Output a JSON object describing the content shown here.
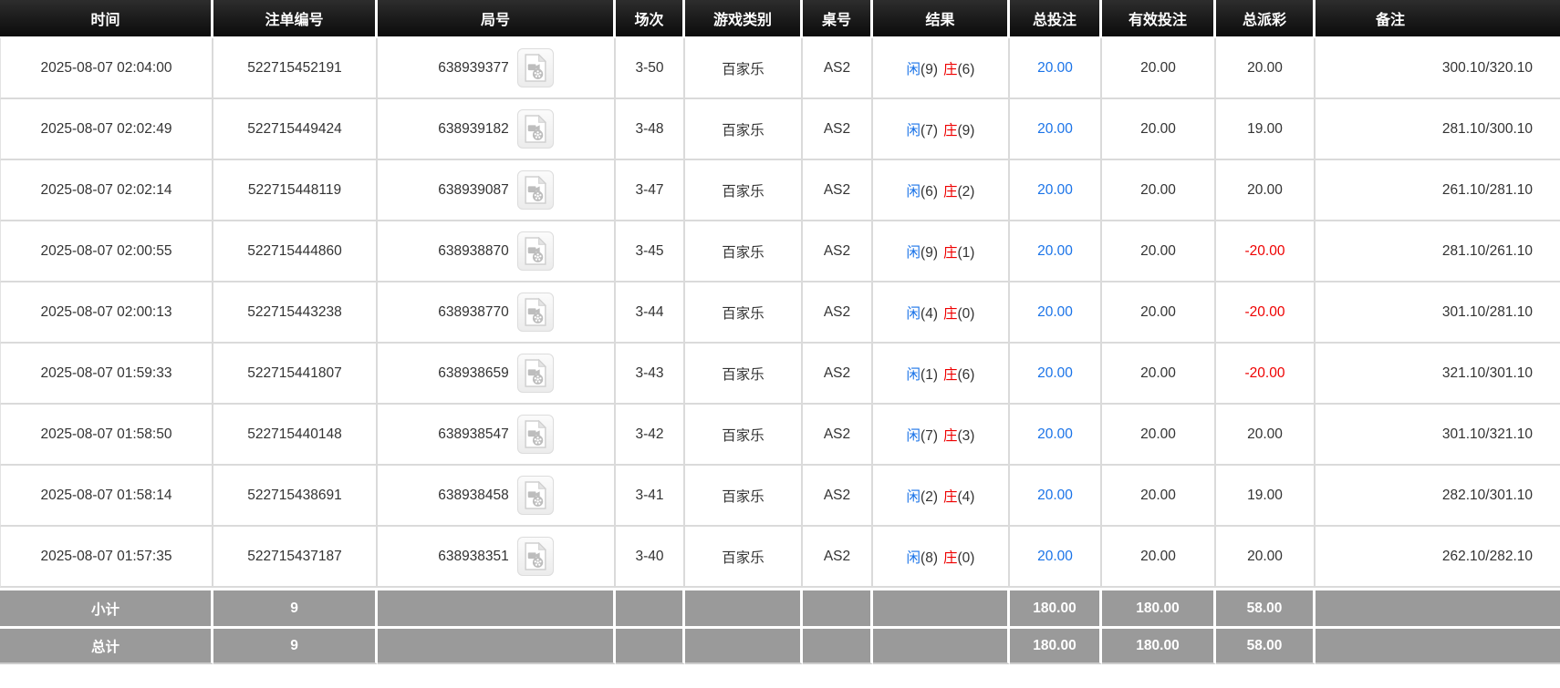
{
  "colors": {
    "header_bg": "#1a1a1a",
    "summary_bg": "#9a9a9a",
    "accent_blue": "#1a73e8",
    "result_player_blue": "#1a73e8",
    "result_banker_red": "#ee0000",
    "negative_red": "#ee0000",
    "border_gray": "#dadada"
  },
  "table": {
    "columns": [
      {
        "label": "时间"
      },
      {
        "label": "注单编号"
      },
      {
        "label": "局号"
      },
      {
        "label": "场次"
      },
      {
        "label": "游戏类别"
      },
      {
        "label": "桌号"
      },
      {
        "label": "结果"
      },
      {
        "label": "总投注"
      },
      {
        "label": "有效投注"
      },
      {
        "label": "总派彩"
      },
      {
        "label": "备注"
      }
    ],
    "rows": [
      {
        "time": "2025-08-07 02:04:00",
        "bet_no": "522715452191",
        "round_no": "638939377",
        "session": "3-50",
        "game_type": "百家乐",
        "table_no": "AS2",
        "player": "闲",
        "player_score": "(9)",
        "banker": "庄",
        "banker_score": "(6)",
        "total_bet": "20.00",
        "valid_bet": "20.00",
        "total_payout": "20.00",
        "remark": "300.10/320.10"
      },
      {
        "time": "2025-08-07 02:02:49",
        "bet_no": "522715449424",
        "round_no": "638939182",
        "session": "3-48",
        "game_type": "百家乐",
        "table_no": "AS2",
        "player": "闲",
        "player_score": "(7)",
        "banker": "庄",
        "banker_score": "(9)",
        "total_bet": "20.00",
        "valid_bet": "20.00",
        "total_payout": "19.00",
        "remark": "281.10/300.10"
      },
      {
        "time": "2025-08-07 02:02:14",
        "bet_no": "522715448119",
        "round_no": "638939087",
        "session": "3-47",
        "game_type": "百家乐",
        "table_no": "AS2",
        "player": "闲",
        "player_score": "(6)",
        "banker": "庄",
        "banker_score": "(2)",
        "total_bet": "20.00",
        "valid_bet": "20.00",
        "total_payout": "20.00",
        "remark": "261.10/281.10"
      },
      {
        "time": "2025-08-07 02:00:55",
        "bet_no": "522715444860",
        "round_no": "638938870",
        "session": "3-45",
        "game_type": "百家乐",
        "table_no": "AS2",
        "player": "闲",
        "player_score": "(9)",
        "banker": "庄",
        "banker_score": "(1)",
        "total_bet": "20.00",
        "valid_bet": "20.00",
        "total_payout": "-20.00",
        "remark": "281.10/261.10"
      },
      {
        "time": "2025-08-07 02:00:13",
        "bet_no": "522715443238",
        "round_no": "638938770",
        "session": "3-44",
        "game_type": "百家乐",
        "table_no": "AS2",
        "player": "闲",
        "player_score": "(4)",
        "banker": "庄",
        "banker_score": "(0)",
        "total_bet": "20.00",
        "valid_bet": "20.00",
        "total_payout": "-20.00",
        "remark": "301.10/281.10"
      },
      {
        "time": "2025-08-07 01:59:33",
        "bet_no": "522715441807",
        "round_no": "638938659",
        "session": "3-43",
        "game_type": "百家乐",
        "table_no": "AS2",
        "player": "闲",
        "player_score": "(1)",
        "banker": "庄",
        "banker_score": "(6)",
        "total_bet": "20.00",
        "valid_bet": "20.00",
        "total_payout": "-20.00",
        "remark": "321.10/301.10"
      },
      {
        "time": "2025-08-07 01:58:50",
        "bet_no": "522715440148",
        "round_no": "638938547",
        "session": "3-42",
        "game_type": "百家乐",
        "table_no": "AS2",
        "player": "闲",
        "player_score": "(7)",
        "banker": "庄",
        "banker_score": "(3)",
        "total_bet": "20.00",
        "valid_bet": "20.00",
        "total_payout": "20.00",
        "remark": "301.10/321.10"
      },
      {
        "time": "2025-08-07 01:58:14",
        "bet_no": "522715438691",
        "round_no": "638938458",
        "session": "3-41",
        "game_type": "百家乐",
        "table_no": "AS2",
        "player": "闲",
        "player_score": "(2)",
        "banker": "庄",
        "banker_score": "(4)",
        "total_bet": "20.00",
        "valid_bet": "20.00",
        "total_payout": "19.00",
        "remark": "282.10/301.10"
      },
      {
        "time": "2025-08-07 01:57:35",
        "bet_no": "522715437187",
        "round_no": "638938351",
        "session": "3-40",
        "game_type": "百家乐",
        "table_no": "AS2",
        "player": "闲",
        "player_score": "(8)",
        "banker": "庄",
        "banker_score": "(0)",
        "total_bet": "20.00",
        "valid_bet": "20.00",
        "total_payout": "20.00",
        "remark": "262.10/282.10"
      }
    ],
    "subtotal": {
      "label": "小计",
      "count": "9",
      "total_bet": "180.00",
      "valid_bet": "180.00",
      "total_payout": "58.00"
    },
    "grand_total": {
      "label": "总计",
      "count": "9",
      "total_bet": "180.00",
      "valid_bet": "180.00",
      "total_payout": "58.00"
    }
  }
}
